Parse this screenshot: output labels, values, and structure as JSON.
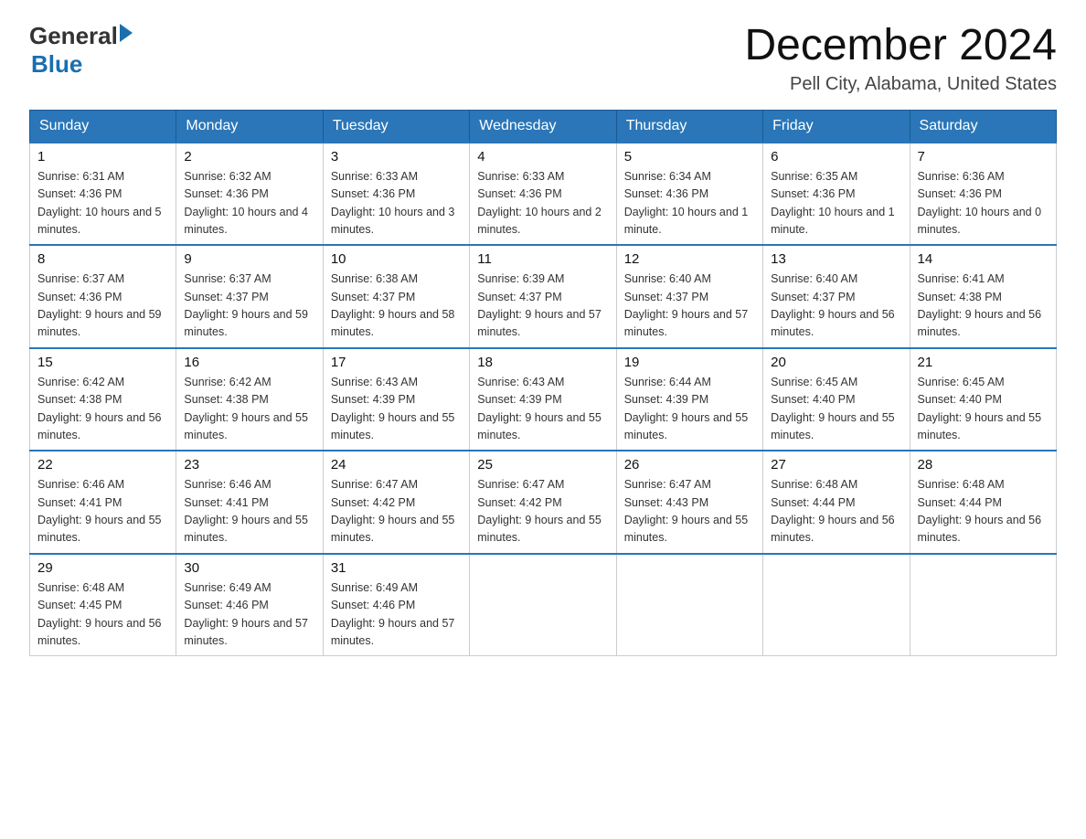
{
  "header": {
    "logo_general": "General",
    "logo_blue": "Blue",
    "month_title": "December 2024",
    "location": "Pell City, Alabama, United States"
  },
  "weekdays": [
    "Sunday",
    "Monday",
    "Tuesday",
    "Wednesday",
    "Thursday",
    "Friday",
    "Saturday"
  ],
  "weeks": [
    [
      {
        "day": "1",
        "sunrise": "6:31 AM",
        "sunset": "4:36 PM",
        "daylight": "10 hours and 5 minutes."
      },
      {
        "day": "2",
        "sunrise": "6:32 AM",
        "sunset": "4:36 PM",
        "daylight": "10 hours and 4 minutes."
      },
      {
        "day": "3",
        "sunrise": "6:33 AM",
        "sunset": "4:36 PM",
        "daylight": "10 hours and 3 minutes."
      },
      {
        "day": "4",
        "sunrise": "6:33 AM",
        "sunset": "4:36 PM",
        "daylight": "10 hours and 2 minutes."
      },
      {
        "day": "5",
        "sunrise": "6:34 AM",
        "sunset": "4:36 PM",
        "daylight": "10 hours and 1 minute."
      },
      {
        "day": "6",
        "sunrise": "6:35 AM",
        "sunset": "4:36 PM",
        "daylight": "10 hours and 1 minute."
      },
      {
        "day": "7",
        "sunrise": "6:36 AM",
        "sunset": "4:36 PM",
        "daylight": "10 hours and 0 minutes."
      }
    ],
    [
      {
        "day": "8",
        "sunrise": "6:37 AM",
        "sunset": "4:36 PM",
        "daylight": "9 hours and 59 minutes."
      },
      {
        "day": "9",
        "sunrise": "6:37 AM",
        "sunset": "4:37 PM",
        "daylight": "9 hours and 59 minutes."
      },
      {
        "day": "10",
        "sunrise": "6:38 AM",
        "sunset": "4:37 PM",
        "daylight": "9 hours and 58 minutes."
      },
      {
        "day": "11",
        "sunrise": "6:39 AM",
        "sunset": "4:37 PM",
        "daylight": "9 hours and 57 minutes."
      },
      {
        "day": "12",
        "sunrise": "6:40 AM",
        "sunset": "4:37 PM",
        "daylight": "9 hours and 57 minutes."
      },
      {
        "day": "13",
        "sunrise": "6:40 AM",
        "sunset": "4:37 PM",
        "daylight": "9 hours and 56 minutes."
      },
      {
        "day": "14",
        "sunrise": "6:41 AM",
        "sunset": "4:38 PM",
        "daylight": "9 hours and 56 minutes."
      }
    ],
    [
      {
        "day": "15",
        "sunrise": "6:42 AM",
        "sunset": "4:38 PM",
        "daylight": "9 hours and 56 minutes."
      },
      {
        "day": "16",
        "sunrise": "6:42 AM",
        "sunset": "4:38 PM",
        "daylight": "9 hours and 55 minutes."
      },
      {
        "day": "17",
        "sunrise": "6:43 AM",
        "sunset": "4:39 PM",
        "daylight": "9 hours and 55 minutes."
      },
      {
        "day": "18",
        "sunrise": "6:43 AM",
        "sunset": "4:39 PM",
        "daylight": "9 hours and 55 minutes."
      },
      {
        "day": "19",
        "sunrise": "6:44 AM",
        "sunset": "4:39 PM",
        "daylight": "9 hours and 55 minutes."
      },
      {
        "day": "20",
        "sunrise": "6:45 AM",
        "sunset": "4:40 PM",
        "daylight": "9 hours and 55 minutes."
      },
      {
        "day": "21",
        "sunrise": "6:45 AM",
        "sunset": "4:40 PM",
        "daylight": "9 hours and 55 minutes."
      }
    ],
    [
      {
        "day": "22",
        "sunrise": "6:46 AM",
        "sunset": "4:41 PM",
        "daylight": "9 hours and 55 minutes."
      },
      {
        "day": "23",
        "sunrise": "6:46 AM",
        "sunset": "4:41 PM",
        "daylight": "9 hours and 55 minutes."
      },
      {
        "day": "24",
        "sunrise": "6:47 AM",
        "sunset": "4:42 PM",
        "daylight": "9 hours and 55 minutes."
      },
      {
        "day": "25",
        "sunrise": "6:47 AM",
        "sunset": "4:42 PM",
        "daylight": "9 hours and 55 minutes."
      },
      {
        "day": "26",
        "sunrise": "6:47 AM",
        "sunset": "4:43 PM",
        "daylight": "9 hours and 55 minutes."
      },
      {
        "day": "27",
        "sunrise": "6:48 AM",
        "sunset": "4:44 PM",
        "daylight": "9 hours and 56 minutes."
      },
      {
        "day": "28",
        "sunrise": "6:48 AM",
        "sunset": "4:44 PM",
        "daylight": "9 hours and 56 minutes."
      }
    ],
    [
      {
        "day": "29",
        "sunrise": "6:48 AM",
        "sunset": "4:45 PM",
        "daylight": "9 hours and 56 minutes."
      },
      {
        "day": "30",
        "sunrise": "6:49 AM",
        "sunset": "4:46 PM",
        "daylight": "9 hours and 57 minutes."
      },
      {
        "day": "31",
        "sunrise": "6:49 AM",
        "sunset": "4:46 PM",
        "daylight": "9 hours and 57 minutes."
      },
      null,
      null,
      null,
      null
    ]
  ],
  "labels": {
    "sunrise_prefix": "Sunrise: ",
    "sunset_prefix": "Sunset: ",
    "daylight_prefix": "Daylight: "
  }
}
